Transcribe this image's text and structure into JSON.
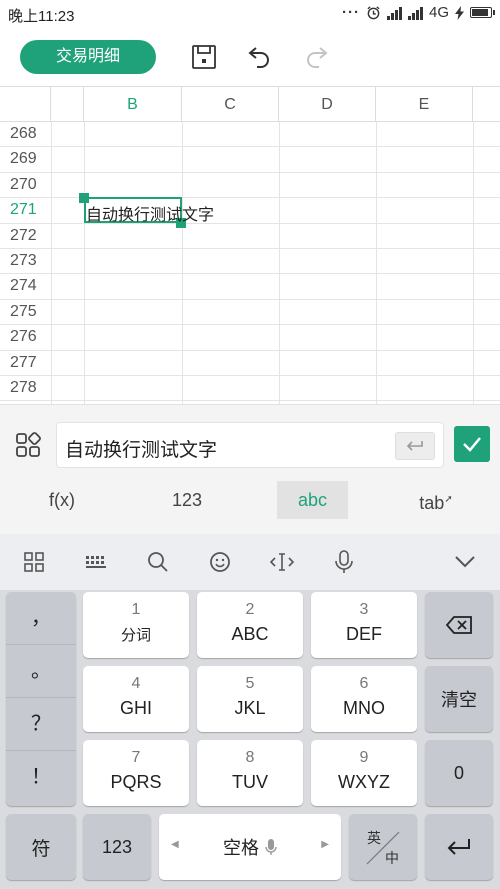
{
  "status_bar": {
    "time": "晚上11:23",
    "network": "4G",
    "dots": "···"
  },
  "toolbar": {
    "trade_button": "交易明细",
    "icons": [
      "save-icon",
      "undo-icon",
      "redo-icon"
    ]
  },
  "sheet": {
    "columns": [
      "B",
      "C",
      "D",
      "E"
    ],
    "rows": [
      "268",
      "269",
      "270",
      "271",
      "272",
      "273",
      "274",
      "275",
      "276",
      "277",
      "278"
    ],
    "active_row": "271",
    "active_column": "B",
    "cell_value": "自动换行测试文字"
  },
  "formula_bar": {
    "value": "自动换行测试文字",
    "modes": [
      "f(x)",
      "123",
      "abc",
      "tab"
    ],
    "active_mode": "abc"
  },
  "keyboard": {
    "punct": [
      "，",
      "。",
      "？",
      "！"
    ],
    "keys": [
      {
        "num": "1",
        "label": "分词"
      },
      {
        "num": "2",
        "label": "ABC"
      },
      {
        "num": "3",
        "label": "DEF"
      },
      {
        "num": "4",
        "label": "GHI"
      },
      {
        "num": "5",
        "label": "JKL"
      },
      {
        "num": "6",
        "label": "MNO"
      },
      {
        "num": "7",
        "label": "PQRS"
      },
      {
        "num": "8",
        "label": "TUV"
      },
      {
        "num": "9",
        "label": "WXYZ"
      }
    ],
    "clear": "清空",
    "zero": "0",
    "symbol": "符",
    "numeric": "123",
    "space": "空格",
    "lang_top": "英",
    "lang_bottom": "中"
  },
  "colors": {
    "accent": "#1fa27a",
    "keyboard_bg": "#d9dbde"
  }
}
